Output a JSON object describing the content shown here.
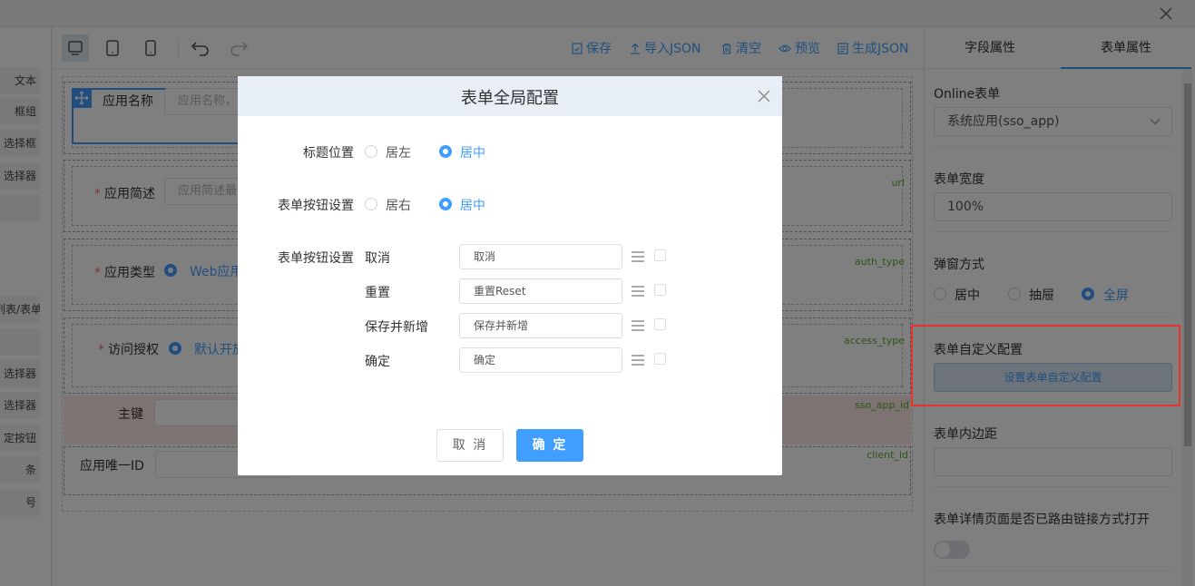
{
  "window": {
    "close_icon": "close-icon"
  },
  "palette": {
    "items": [
      "文本",
      "框组",
      "选择框",
      "选择器",
      "",
      "",
      "列表/表单",
      "",
      "选择器",
      "选择器",
      "定按钮",
      "条",
      "号"
    ]
  },
  "toolbar": {
    "devices": [
      "desktop",
      "tablet",
      "mobile"
    ],
    "actions": {
      "save": "保存",
      "import": "导入JSON",
      "clear": "清空",
      "preview": "预览",
      "generate": "生成JSON"
    }
  },
  "canvas": {
    "fields": [
      {
        "label": "应用名称",
        "required": false,
        "placeholder": "应用名称，",
        "tag": ""
      },
      {
        "label": "应用简述",
        "required": true,
        "placeholder": "应用简述最",
        "tag": "url"
      },
      {
        "label": "应用类型",
        "required": true,
        "value": "Web应用",
        "tag": "auth_type"
      },
      {
        "label": "访问授权",
        "required": true,
        "value": "默认开放",
        "tag": "access_type"
      },
      {
        "label": "主键",
        "required": false,
        "placeholder": "",
        "tag": "sso_app_id"
      },
      {
        "label": "应用唯一ID",
        "required": false,
        "placeholder": "",
        "tag": "client_id"
      }
    ],
    "required_mark": "*"
  },
  "right_panel": {
    "tabs": [
      "字段属性",
      "表单属性"
    ],
    "active_tab": 1,
    "online_label": "Online表单",
    "online_value": "系统应用(sso_app)",
    "width_label": "表单宽度",
    "width_value": "100%",
    "popup_label": "弹窗方式",
    "popup_options": [
      "居中",
      "抽屉",
      "全屏"
    ],
    "popup_selected": 2,
    "custom_label": "表单自定义配置",
    "custom_button": "设置表单自定义配置",
    "padding_label": "表单内边距",
    "padding_value": "",
    "detail_label": "表单详情页面是否已路由链接方式打开",
    "detail_switch": false
  },
  "modal": {
    "title": "表单全局配置",
    "title_position_label": "标题位置",
    "title_position_options": [
      "居左",
      "居中"
    ],
    "title_position_selected": 1,
    "button_align_label": "表单按钮设置",
    "button_align_options": [
      "居右",
      "居中"
    ],
    "button_align_selected": 1,
    "buttons_label": "表单按钮设置",
    "button_rows": [
      {
        "name": "取消",
        "value": "取消"
      },
      {
        "name": "重置",
        "value": "重置Reset"
      },
      {
        "name": "保存并新增",
        "value": "保存并新增"
      },
      {
        "name": "确定",
        "value": "确定"
      }
    ],
    "cancel": "取 消",
    "confirm": "确 定"
  },
  "colors": {
    "primary": "#409eff",
    "highlight_frame": "#e8322d",
    "field_tag": "#5bab2d"
  }
}
